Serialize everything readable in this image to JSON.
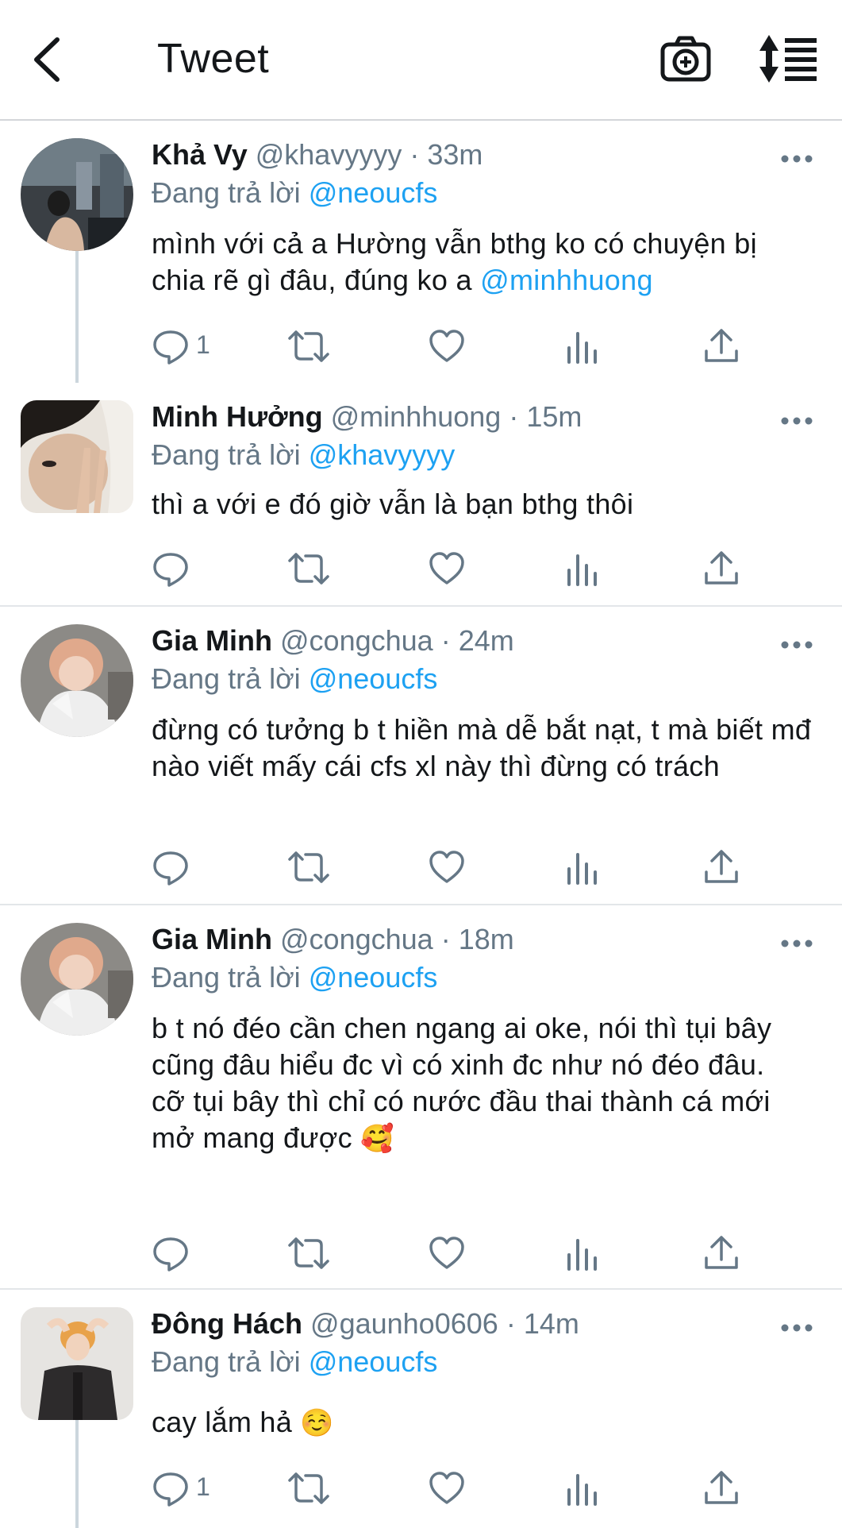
{
  "header": {
    "title": "Tweet",
    "icons": [
      "back-arrow-icon",
      "camera-plus-icon",
      "sort-list-icon"
    ]
  },
  "colors": {
    "link": "#1da1f2",
    "secondary_text": "#657786",
    "primary_text": "#14171a",
    "divider": "#e3e6e9"
  },
  "reply_prefix": "Đang trả lời",
  "tweets": [
    {
      "name": "Khả Vy",
      "handle": "@khavyyyy",
      "dot": "·",
      "time": "33m",
      "reply_to": "@neoucfs",
      "text_before": "mình với cả a Hường vẫn bthg ko có chuyện bị chia rẽ gì đâu, đúng ko a ",
      "text_mention": "@minhhuong",
      "reply_count": "1"
    },
    {
      "name": "Minh Hưởng",
      "handle": "@minhhuong",
      "dot": "·",
      "time": "15m",
      "reply_to": "@khavyyyy",
      "text": "thì a với e đó giờ vẫn là bạn bthg thôi",
      "reply_count": ""
    },
    {
      "name": "Gia Minh",
      "handle": "@congchua",
      "dot": "·",
      "time": "24m",
      "reply_to": "@neoucfs",
      "text": "đừng có tưởng b t hiền mà dễ bắt nạt, t mà biết mđ nào viết mấy cái cfs xl này thì đừng có trách",
      "reply_count": ""
    },
    {
      "name": "Gia Minh",
      "handle": "@congchua",
      "dot": "·",
      "time": "18m",
      "reply_to": "@neoucfs",
      "text_line1": "b t nó đéo cần chen ngang ai oke, nói thì tụi bây cũng đâu hiểu đc vì có xinh đc như nó đéo đâu.",
      "text_line2": "cỡ tụi bây thì chỉ có nước đầu thai thành cá mới mở mang được",
      "emoji": "🥰",
      "reply_count": ""
    },
    {
      "name": "Đông Hách",
      "handle": "@gaunho0606",
      "dot": "·",
      "time": "14m",
      "reply_to": "@neoucfs",
      "text": "cay lắm hả",
      "emoji": "☺️",
      "reply_count": "1"
    }
  ]
}
